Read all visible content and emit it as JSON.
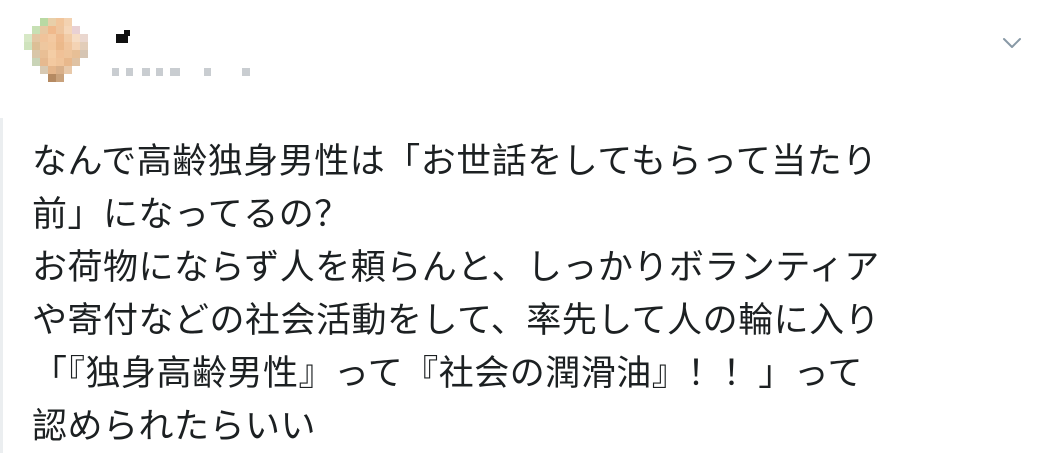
{
  "tweet": {
    "lines": [
      "なんで高齢独身男性は「お世話をしてもらって当たり",
      "前」になってるの？",
      "お荷物にならず人を頼らんと、しっかりボランティア",
      "や寄付などの社会活動をして、率先して人の輪に入り",
      "「『独身高齢男性』って『社会の潤滑油』！！」って",
      "認められたらいい"
    ]
  },
  "header": {
    "avatar_state": "pixelated",
    "name_state": "pixelated",
    "handle_state": "pixelated",
    "menu_icon": "chevron-down-icon"
  },
  "colors": {
    "text": "#1c2022",
    "caret": "#8899a6",
    "rule": "#ebeef0"
  }
}
